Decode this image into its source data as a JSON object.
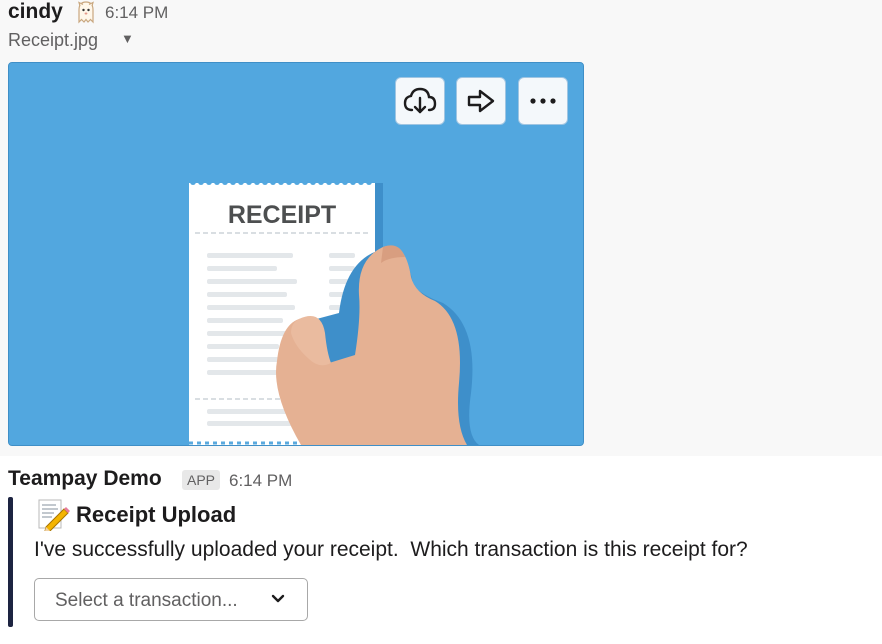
{
  "message1": {
    "author": "cindy",
    "avatar_icon": "ghost-emoji",
    "time": "6:14 PM",
    "file_name": "Receipt.jpg",
    "file_menu_icon": "caret-down-icon",
    "image": {
      "receipt_title": "RECEIPT",
      "bg_color": "#52a7df"
    },
    "actions": [
      {
        "name": "download",
        "icon": "cloud-download-icon"
      },
      {
        "name": "share",
        "icon": "arrow-right-icon"
      },
      {
        "name": "more",
        "icon": "ellipsis-icon"
      }
    ]
  },
  "message2": {
    "author": "Teampay Demo",
    "badge": "APP",
    "time": "6:14 PM",
    "attachment": {
      "icon": "memo-pencil-emoji",
      "title": "Receipt Upload",
      "text": "I've successfully uploaded your receipt.  Which transaction is this receipt for?",
      "select_placeholder": "Select a transaction...",
      "bar_color": "#1d2441"
    }
  }
}
